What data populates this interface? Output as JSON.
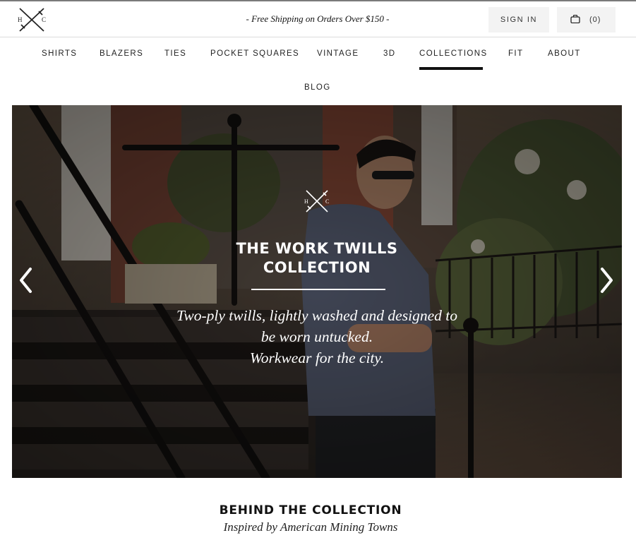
{
  "header": {
    "logo_letters": [
      "H",
      "C"
    ],
    "promo": "- Free Shipping on Orders Over $150 -",
    "signin_label": "SIGN IN",
    "cart_count": "(0)"
  },
  "nav": {
    "items": [
      "SHIRTS",
      "BLAZERS",
      "TIES",
      "POCKET SQUARES",
      "VINTAGE",
      "3D",
      "COLLECTIONS",
      "FIT",
      "ABOUT",
      "BLOG"
    ],
    "active": "COLLECTIONS"
  },
  "hero": {
    "logo_letters": [
      "H",
      "C"
    ],
    "title_line1": "THE WORK TWILLS",
    "title_line2": "COLLECTION",
    "text_line1": "Two-ply twills, lightly washed and designed to",
    "text_line2": "be worn untucked.",
    "text_line3": "Workwear for the city."
  },
  "section": {
    "title": "BEHIND THE COLLECTION",
    "subtitle": "Inspired by American Mining Towns"
  },
  "icons": {
    "logo": "crossed-swords-logo-icon",
    "cart": "shopping-bag-icon",
    "prev": "chevron-left-icon",
    "next": "chevron-right-icon"
  }
}
